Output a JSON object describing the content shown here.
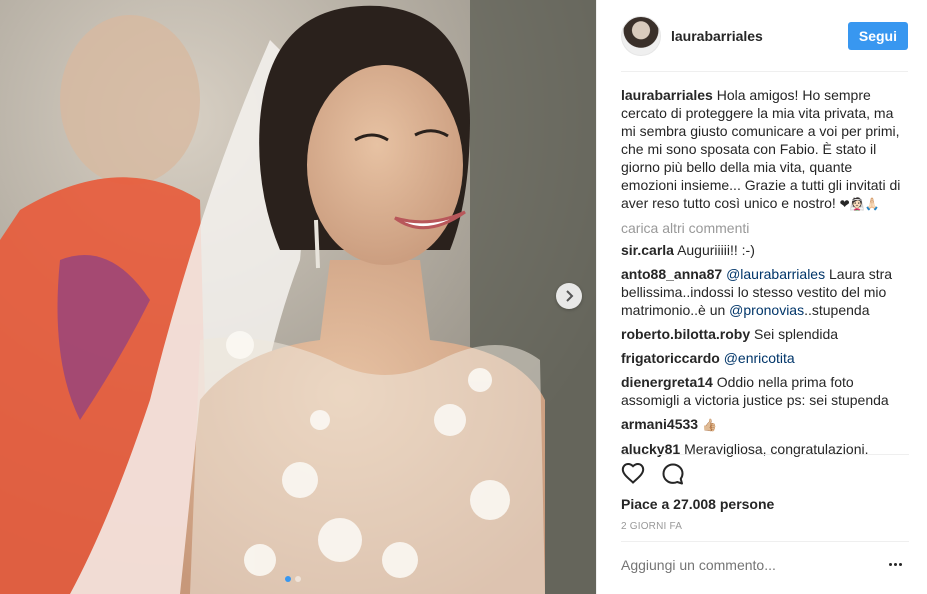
{
  "post": {
    "username": "laurabarriales",
    "follow_label": "Segui",
    "caption_text": "Hola amigos! Ho sempre cercato di proteggere la mia vita privata, ma mi sembra giusto comunicare a voi per primi, che mi sono sposata con Fabio. È stato il giorno più bello della mia vita, quante emozioni insieme... Grazie a tutti gli invitati di aver reso tutto così unico e nostro! ",
    "caption_emoji": "❤👰🏻🙏🏻",
    "load_more": "carica altri commenti",
    "likes": "Piace a 27.008 persone",
    "time": "2 GIORNI FA",
    "comment_placeholder": "Aggiungi un commento..."
  },
  "comments": [
    {
      "user": "sir.carla",
      "text": "Auguriiiii!! :-)"
    },
    {
      "user": "anto88_anna87",
      "mention": "@laurabarriales",
      "text": " Laura stra bellissima..indossi lo stesso vestito del mio matrimonio..è un ",
      "mention2": "@pronovias",
      "text2": "..stupenda"
    },
    {
      "user": "roberto.bilotta.roby",
      "text": "Sei splendida"
    },
    {
      "user": "frigatoriccardo",
      "mention": "@enricotita"
    },
    {
      "user": "dienergreta14",
      "text": "Oddio nella prima foto assomigli a victoria justice ps: sei stupenda"
    },
    {
      "user": "armani4533",
      "emoji": "👍🏼"
    },
    {
      "user": "alucky81",
      "text": "Meravigliosa, congratulazioni."
    }
  ],
  "icons": {
    "like": "heart-icon",
    "comment": "comment-bubble-icon",
    "next": "chevron-right-icon",
    "options": "more-options-icon"
  },
  "colors": {
    "accent": "#3897f0",
    "mention": "#003569",
    "muted": "#999999"
  }
}
